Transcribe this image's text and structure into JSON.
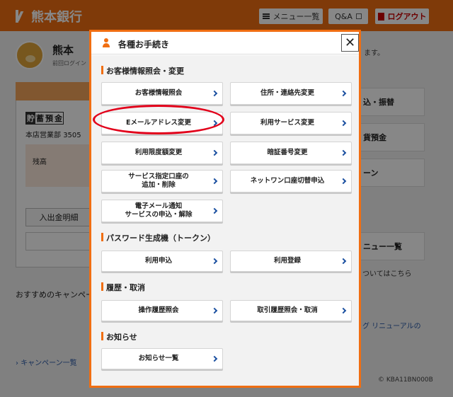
{
  "header": {
    "bank_name": "熊本銀行",
    "menu_label": "メニュー一覧",
    "qa_label": "Q&A",
    "logout_label": "ログアウト"
  },
  "background": {
    "user_name": "熊本",
    "last_login": "前回ログイン",
    "suffix_text": "ます。",
    "account_tag": [
      "貯",
      "蓄",
      "預",
      "金"
    ],
    "branch": "本店営業部",
    "account_number_partial": "3505",
    "balance_label": "残高",
    "deposit_button": "入出金明細",
    "campaign_heading": "おすすめのキャンペー",
    "campaign_link": "キャンペーン一覧",
    "right_items": [
      "込・振替",
      "貨預金",
      "ーン",
      "ニュー一覧"
    ],
    "right_link_1": "ついてはこちら",
    "right_link_2": "グ リニューアルの",
    "copyright": "KBA11BN000B"
  },
  "modal": {
    "title": "各種お手続き",
    "close_label": "✕",
    "sections": {
      "customer": {
        "title": "お客様情報照会・変更",
        "buttons": {
          "info_inquiry": "お客様情報照会",
          "address_change": "住所・連絡先変更",
          "email_change": "Eメールアドレス変更",
          "service_change": "利用サービス変更",
          "limit_change": "利用限度額変更",
          "pin_change": "暗証番号変更",
          "designated_account_line1": "サービス指定口座の",
          "designated_account_line2": "追加・削除",
          "netone_switch": "ネットワン口座切替申込",
          "email_notice_line1": "電子メール通知",
          "email_notice_line2": "サービスの申込・解除"
        }
      },
      "token": {
        "title": "パスワード生成機（トークン）",
        "buttons": {
          "apply": "利用申込",
          "register": "利用登録"
        }
      },
      "history": {
        "title": "履歴・取消",
        "buttons": {
          "operation_history": "操作履歴照会",
          "transaction_history": "取引履歴照会・取消"
        }
      },
      "notices": {
        "title": "お知らせ",
        "buttons": {
          "notice_list": "お知らせ一覧"
        }
      }
    }
  },
  "colors": {
    "brand_orange": "#f06e12",
    "chevron_blue": "#1a4fa0",
    "highlight_red": "#e2001a"
  }
}
